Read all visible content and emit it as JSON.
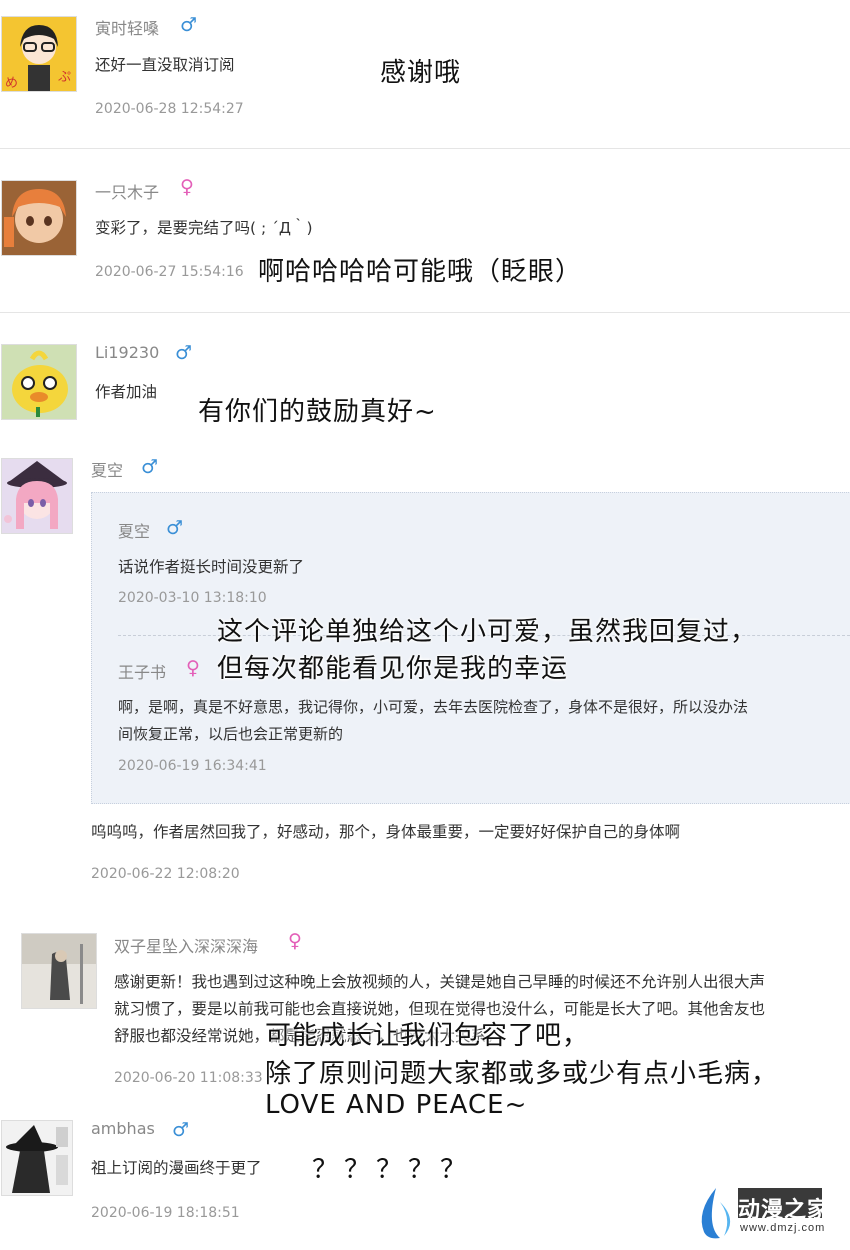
{
  "comments": [
    {
      "user": "寅时轻嗓",
      "gender": "♂",
      "text": "还好一直没取消订阅",
      "time": "2020-06-28 12:54:27",
      "annotation": "感谢哦"
    },
    {
      "user": "一只木子",
      "gender": "♀",
      "text": "变彩了，是要完结了吗( ; ´Д｀)",
      "time": "2020-06-27 15:54:16",
      "annotation": "啊哈哈哈哈可能哦（眨眼）"
    },
    {
      "user": "Li19230",
      "gender": "♂",
      "text": "作者加油",
      "annotation": "有你们的鼓励真好~"
    },
    {
      "user": "夏空",
      "gender": "♂",
      "quote1": {
        "user": "夏空",
        "gender": "♂",
        "text": "话说作者挺长时间没更新了",
        "time": "2020-03-10 13:18:10"
      },
      "quote2": {
        "user": "王子书",
        "gender": "♀",
        "text_line1": "啊，是啊，真是不好意思，我记得你，小可爱，去年去医院检查了，身体不是很好，所以没办法",
        "text_line2": "间恢复正常，以后也会正常更新的",
        "time": "2020-06-19 16:34:41"
      },
      "text": "呜呜呜，作者居然回我了，好感动，那个，身体最重要，一定要好好保护自己的身体啊",
      "time": "2020-06-22 12:08:20",
      "annotation_line1": "这个评论单独给这个小可爱，虽然我回复过，",
      "annotation_line2": "但每次都能看见你是我的幸运"
    },
    {
      "user": "双子星坠入深深深海",
      "gender": "♀",
      "text_line1": "感谢更新！我也遇到过这种晚上会放视频的人，关键是她自己早睡的时候还不允许别人出很大声",
      "text_line2": "就习惯了，要是以前我可能也会直接说她，但现在觉得也没什么，可能是长大了吧。其他舍友也",
      "text_line3": "舒服也都没经常说她，都是能忍就忍了，也没太大关系。",
      "time": "2020-06-20 11:08:33",
      "annotation_line1": "可能成长让我们包容了吧，",
      "annotation_line2": "除了原则问题大家都或多或少有点小毛病，",
      "annotation_line3": "LOVE AND PEACE~"
    },
    {
      "user": "ambhas",
      "gender": "♂",
      "text": "祖上订阅的漫画终于更了",
      "time": "2020-06-19 18:18:51",
      "annotation": "？？？？？"
    }
  ],
  "logo": {
    "text": "动漫之家",
    "url": "www.dmzj.com"
  },
  "colors": {
    "male": "#3a8fd6",
    "female": "#e35fb8",
    "quote_bg": "#eef2f8"
  }
}
